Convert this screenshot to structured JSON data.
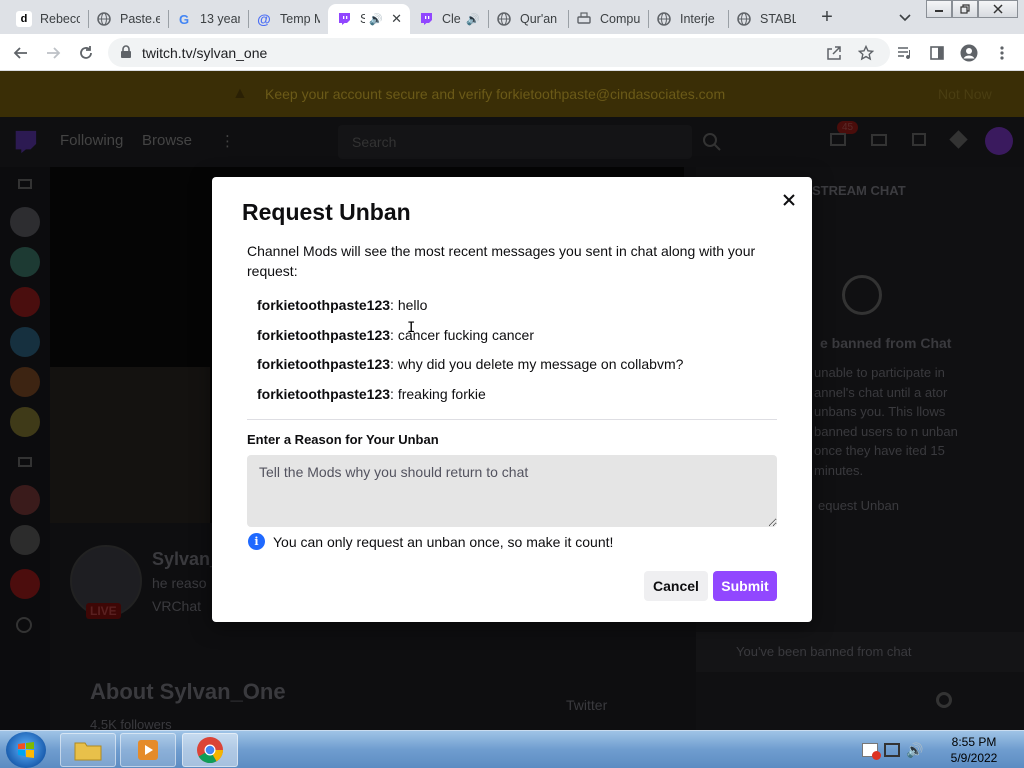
{
  "browser": {
    "tabs": [
      {
        "title": "Rebecc",
        "favicon": "d"
      },
      {
        "title": "Paste.e",
        "favicon": "globe-icon"
      },
      {
        "title": "13 year",
        "favicon": "G"
      },
      {
        "title": "Temp M",
        "favicon": "at-icon"
      },
      {
        "title": "S",
        "favicon": "twitch-icon",
        "active": true,
        "audio": true
      },
      {
        "title": "Cle",
        "favicon": "twitch-icon",
        "audio": true
      },
      {
        "title": "Qur'an",
        "favicon": "globe-icon"
      },
      {
        "title": "Compu",
        "favicon": "printer-icon"
      },
      {
        "title": "Interje",
        "favicon": "globe-icon"
      },
      {
        "title": "STABLE",
        "favicon": "globe-icon"
      }
    ],
    "url": "twitch.tv/sylvan_one",
    "new_tab": "+"
  },
  "background": {
    "banner_text": "Keep your account secure and verify forkietoothpaste@cindasociates.com",
    "banner_action": "Not Now",
    "nav_following": "Following",
    "nav_browse": "Browse",
    "search_placeholder": "Search",
    "notification_count": "45",
    "chat_header": "STREAM CHAT",
    "banned_title": "e banned from Chat",
    "banned_body": "unable to participate in annel's chat until a ator unbans you. This llows banned users to n unban once they have ited 15 minutes.",
    "request_unban_link": "equest Unban",
    "chat_input_placeholder": "You've been banned from chat",
    "channel_name": "Sylvan_",
    "channel_sub1": "he reaso",
    "channel_sub2": "VRChat",
    "live_badge": "LIVE",
    "about": "About Sylvan_One",
    "followers": "4.5K followers",
    "twitter": "Twitter"
  },
  "modal": {
    "title": "Request Unban",
    "intro": "Channel Mods will see the most recent messages you sent in chat along with your request:",
    "messages": [
      {
        "user": "forkietoothpaste123",
        "text": ": hello"
      },
      {
        "user": "forkietoothpaste123",
        "text": ": cancer fucking cancer"
      },
      {
        "user": "forkietoothpaste123",
        "text": ": why did you delete my message on collabvm?"
      },
      {
        "user": "forkietoothpaste123",
        "text": ": freaking forkie"
      }
    ],
    "reason_label": "Enter a Reason for Your Unban",
    "reason_placeholder": "Tell the Mods why you should return to chat",
    "info_text": "You can only request an unban once, so make it count!",
    "cancel_label": "Cancel",
    "submit_label": "Submit"
  },
  "taskbar": {
    "time": "8:55 PM",
    "date": "5/9/2022"
  },
  "colors": {
    "accent": "#9147ff",
    "info": "#1f69ff",
    "live": "#e91916"
  }
}
